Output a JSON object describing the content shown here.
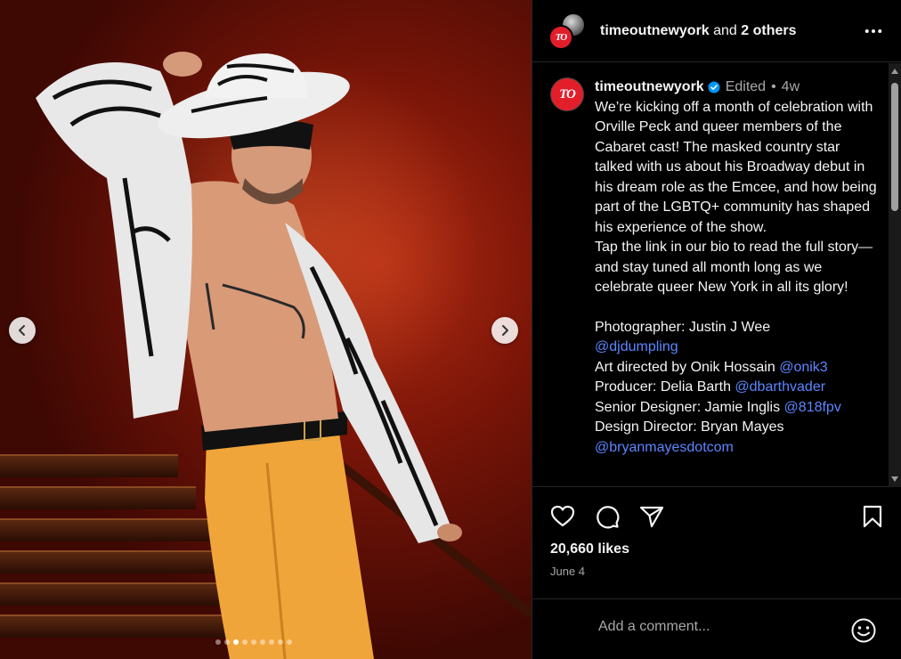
{
  "header": {
    "account": "timeoutnewyork",
    "and_text": " and ",
    "others": "2 others",
    "avatar_logo": "TO",
    "more_icon": "more-horizontal-icon"
  },
  "caption": {
    "username": "timeoutnewyork",
    "edited": "Edited",
    "separator": "•",
    "age": "4w",
    "text": "We’re kicking off a month of celebration with Orville Peck and queer members of the Cabaret cast! The masked country star talked with us about his Broadway debut in his dream role as the Emcee, and how being part of the LGBTQ+ community has shaped his experience of the show.\nTap the link in our bio to read the full story—and stay tuned all month long as we celebrate queer New York in all its glory!",
    "credits": [
      {
        "label": "Photographer: Justin J Wee",
        "link": ""
      },
      {
        "label": "",
        "link": "@djdumpling"
      },
      {
        "label": "Art directed by  Onik Hossain  ",
        "link": "@onik3"
      },
      {
        "label": "Producer: Delia Barth ",
        "link": "@dbarthvader"
      },
      {
        "label": "Senior Designer: Jamie Inglis  ",
        "link": "@818fpv"
      },
      {
        "label": "Design Director: Bryan Mayes",
        "link": ""
      },
      {
        "label": "",
        "link": "@bryanmayesdotcom"
      }
    ]
  },
  "media": {
    "slide_count": 9,
    "active_slide": 2
  },
  "actions": {
    "like_icon": "heart-icon",
    "comment_icon": "comment-icon",
    "share_icon": "send-icon",
    "save_icon": "bookmark-icon"
  },
  "likes": "20,660 likes",
  "date": "June 4",
  "comment": {
    "placeholder": "Add a comment...",
    "emoji_icon": "emoji-icon"
  },
  "colors": {
    "brand_red": "#e21e2b",
    "link_blue": "#5c86ff",
    "verified_blue": "#0095f6",
    "muted_text": "#a8a8a8"
  }
}
